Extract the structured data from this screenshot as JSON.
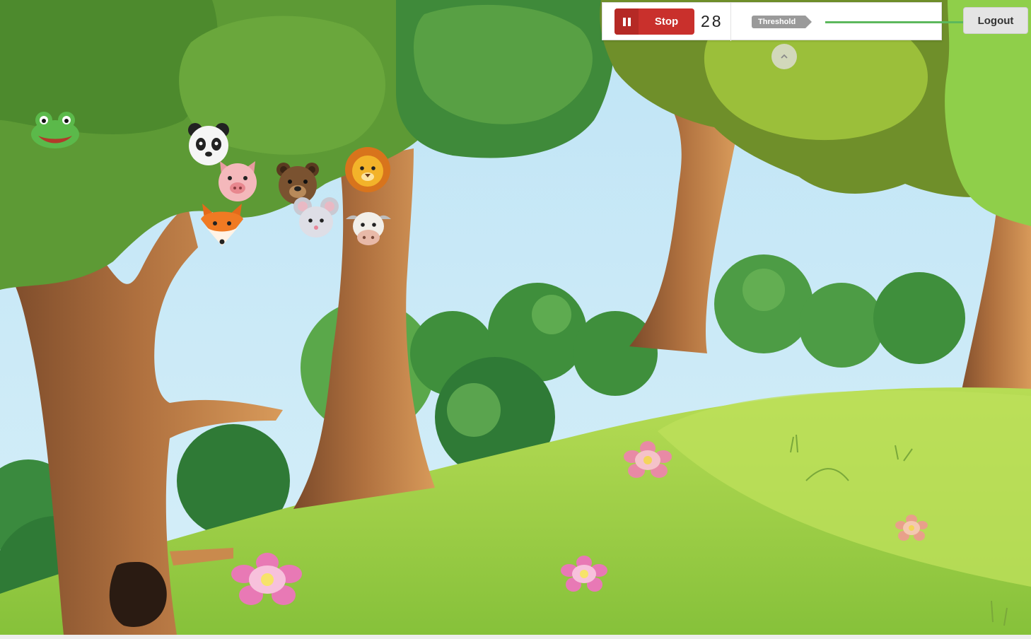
{
  "controls": {
    "stop_label": "Stop",
    "counter": "28",
    "threshold_label": "Threshold",
    "logout_label": "Logout",
    "collapse_icon": "chevron-up-icon"
  },
  "colors": {
    "stop": "#c9302c",
    "slider": "#5cb85c",
    "sky": "#c4e6f5",
    "grass": "#a6d14a",
    "trunk": "#a86a3c"
  },
  "animals": [
    "frog",
    "panda",
    "pig",
    "bear",
    "lion",
    "fox",
    "mouse",
    "cow"
  ],
  "flowers": 4
}
